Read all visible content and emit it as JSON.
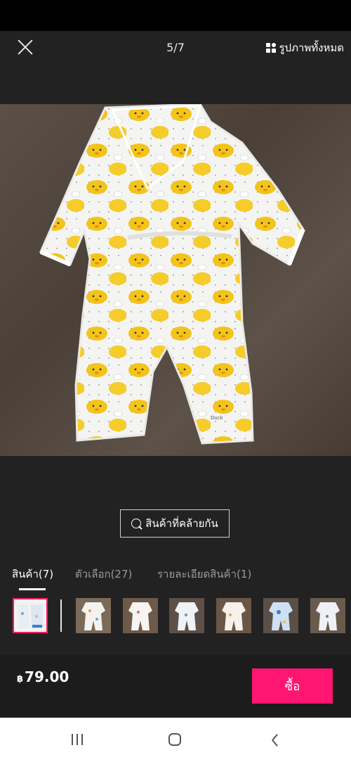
{
  "viewer": {
    "counter": "5/7",
    "all_photos_label": "รูปภาพทั้งหมด",
    "close_icon": "close-icon",
    "all_photos_icon": "grid-icon"
  },
  "photo": {
    "garment_print": "Duck"
  },
  "similar": {
    "label": "สินค้าที่คล้ายกัน",
    "icon": "search-icon"
  },
  "tabs": [
    {
      "label": "สินค้า(7)",
      "active": true
    },
    {
      "label": "ตัวเลือก(27)",
      "active": false
    },
    {
      "label": "รายละเอียดสินค้า(1)",
      "active": false
    }
  ],
  "thumbnails": {
    "count": 7,
    "selected_index": 0
  },
  "purchase": {
    "currency": "฿",
    "price": "79.00",
    "buy_label": "ซื้อ"
  },
  "colors": {
    "accent": "#ff1670",
    "background": "#222222"
  }
}
